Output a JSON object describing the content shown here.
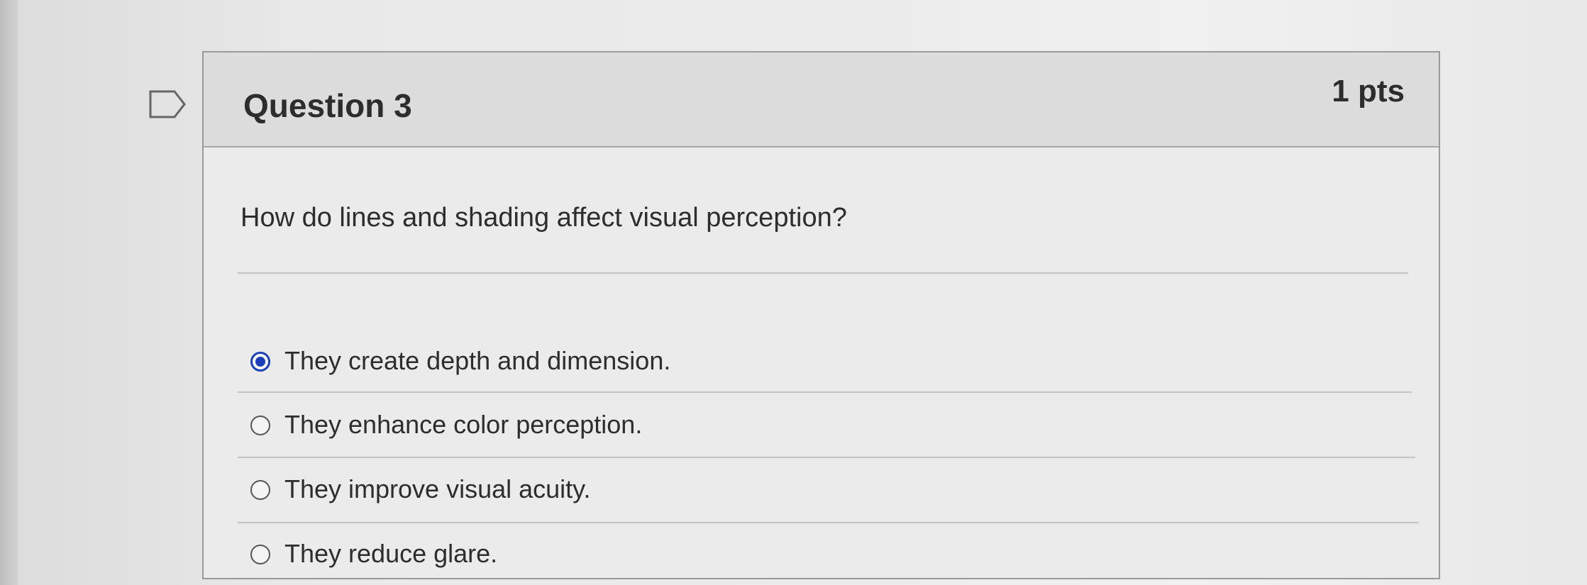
{
  "question": {
    "title": "Question 3",
    "points": "1 pts",
    "text": "How do lines and shading affect visual perception?",
    "flag_icon": "flag-outline-icon"
  },
  "answers": [
    {
      "label": "They create depth and dimension.",
      "selected": true
    },
    {
      "label": "They enhance color perception.",
      "selected": false
    },
    {
      "label": "They improve visual acuity.",
      "selected": false
    },
    {
      "label": "They reduce glare.",
      "selected": false
    }
  ],
  "colors": {
    "selected_radio": "#1a3fb8",
    "text": "#2d2d2d"
  }
}
